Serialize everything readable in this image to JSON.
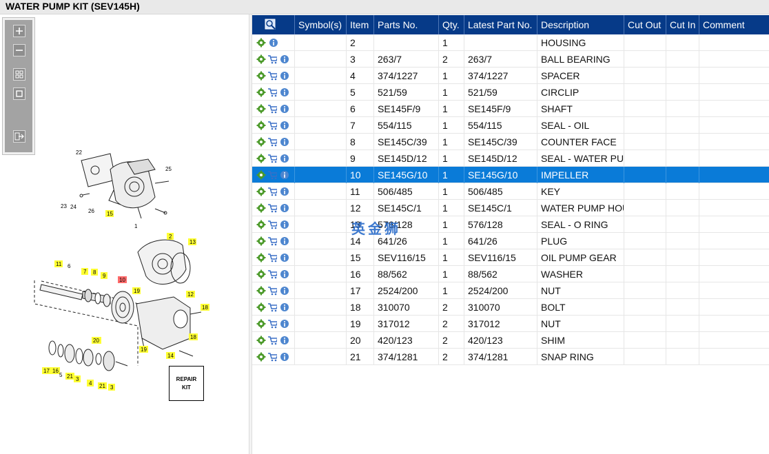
{
  "window": {
    "title": "WATER PUMP KIT (SEV145H)"
  },
  "toolbar": {
    "buttons": [
      {
        "name": "zoom-in",
        "icon": "plus-icon"
      },
      {
        "name": "zoom-out",
        "icon": "minus-icon"
      },
      {
        "name": "fit",
        "icon": "grid-icon"
      },
      {
        "name": "actual-size",
        "icon": "square-icon"
      },
      {
        "name": "export",
        "icon": "export-arrow-icon"
      }
    ]
  },
  "diagram": {
    "callouts": [
      "22",
      "25",
      "23",
      "24",
      "26",
      "15",
      "1",
      "2",
      "13",
      "11",
      "6",
      "7",
      "8",
      "9",
      "10",
      "19",
      "12",
      "18",
      "18",
      "19",
      "14",
      "20",
      "17",
      "16",
      "5",
      "21",
      "3",
      "4",
      "21",
      "3"
    ],
    "highlighted_callout": "10",
    "repair_kit_label_line1": "REPAIR",
    "repair_kit_label_line2": "KIT"
  },
  "table": {
    "columns": [
      "Symbol(s)",
      "Item",
      "Parts No.",
      "Qty.",
      "Latest Part No.",
      "Description",
      "Cut Out",
      "Cut In",
      "Comment"
    ],
    "selected_index": 8,
    "rows": [
      {
        "item": "2",
        "parts_no": "",
        "qty": "1",
        "latest": "",
        "desc": "HOUSING",
        "cart": false
      },
      {
        "item": "3",
        "parts_no": "263/7",
        "qty": "2",
        "latest": "263/7",
        "desc": "BALL BEARING",
        "cart": true
      },
      {
        "item": "4",
        "parts_no": "374/1227",
        "qty": "1",
        "latest": "374/1227",
        "desc": "SPACER",
        "cart": true
      },
      {
        "item": "5",
        "parts_no": "521/59",
        "qty": "1",
        "latest": "521/59",
        "desc": "CIRCLIP",
        "cart": true
      },
      {
        "item": "6",
        "parts_no": "SE145F/9",
        "qty": "1",
        "latest": "SE145F/9",
        "desc": "SHAFT",
        "cart": true
      },
      {
        "item": "7",
        "parts_no": "554/115",
        "qty": "1",
        "latest": "554/115",
        "desc": "SEAL - OIL",
        "cart": true
      },
      {
        "item": "8",
        "parts_no": "SE145C/39",
        "qty": "1",
        "latest": "SE145C/39",
        "desc": "COUNTER FACE",
        "cart": true
      },
      {
        "item": "9",
        "parts_no": "SE145D/12",
        "qty": "1",
        "latest": "SE145D/12",
        "desc": "SEAL - WATER PUMP",
        "cart": true
      },
      {
        "item": "10",
        "parts_no": "SE145G/10",
        "qty": "1",
        "latest": "SE145G/10",
        "desc": "IMPELLER",
        "cart": true
      },
      {
        "item": "11",
        "parts_no": "506/485",
        "qty": "1",
        "latest": "506/485",
        "desc": "KEY",
        "cart": true
      },
      {
        "item": "12",
        "parts_no": "SE145C/1",
        "qty": "1",
        "latest": "SE145C/1",
        "desc": "WATER PUMP HOUSING",
        "cart": true
      },
      {
        "item": "13",
        "parts_no": "576/128",
        "qty": "1",
        "latest": "576/128",
        "desc": "SEAL - O RING",
        "cart": true
      },
      {
        "item": "14",
        "parts_no": "641/26",
        "qty": "1",
        "latest": "641/26",
        "desc": "PLUG",
        "cart": true
      },
      {
        "item": "15",
        "parts_no": "SEV116/15",
        "qty": "1",
        "latest": "SEV116/15",
        "desc": "OIL PUMP GEAR",
        "cart": true
      },
      {
        "item": "16",
        "parts_no": "88/562",
        "qty": "1",
        "latest": "88/562",
        "desc": "WASHER",
        "cart": true
      },
      {
        "item": "17",
        "parts_no": "2524/200",
        "qty": "1",
        "latest": "2524/200",
        "desc": "NUT",
        "cart": true
      },
      {
        "item": "18",
        "parts_no": "310070",
        "qty": "2",
        "latest": "310070",
        "desc": "BOLT",
        "cart": true
      },
      {
        "item": "19",
        "parts_no": "317012",
        "qty": "2",
        "latest": "317012",
        "desc": "NUT",
        "cart": true
      },
      {
        "item": "20",
        "parts_no": "420/123",
        "qty": "2",
        "latest": "420/123",
        "desc": "SHIM",
        "cart": true
      },
      {
        "item": "21",
        "parts_no": "374/1281",
        "qty": "2",
        "latest": "374/1281",
        "desc": "SNAP RING",
        "cart": true
      }
    ]
  },
  "watermark": "英金狮",
  "colors": {
    "header_bg": "#063a88",
    "selected_row": "#0a7bd8",
    "callout_yellow": "#ffff33",
    "callout_red": "#ff6b6b"
  }
}
